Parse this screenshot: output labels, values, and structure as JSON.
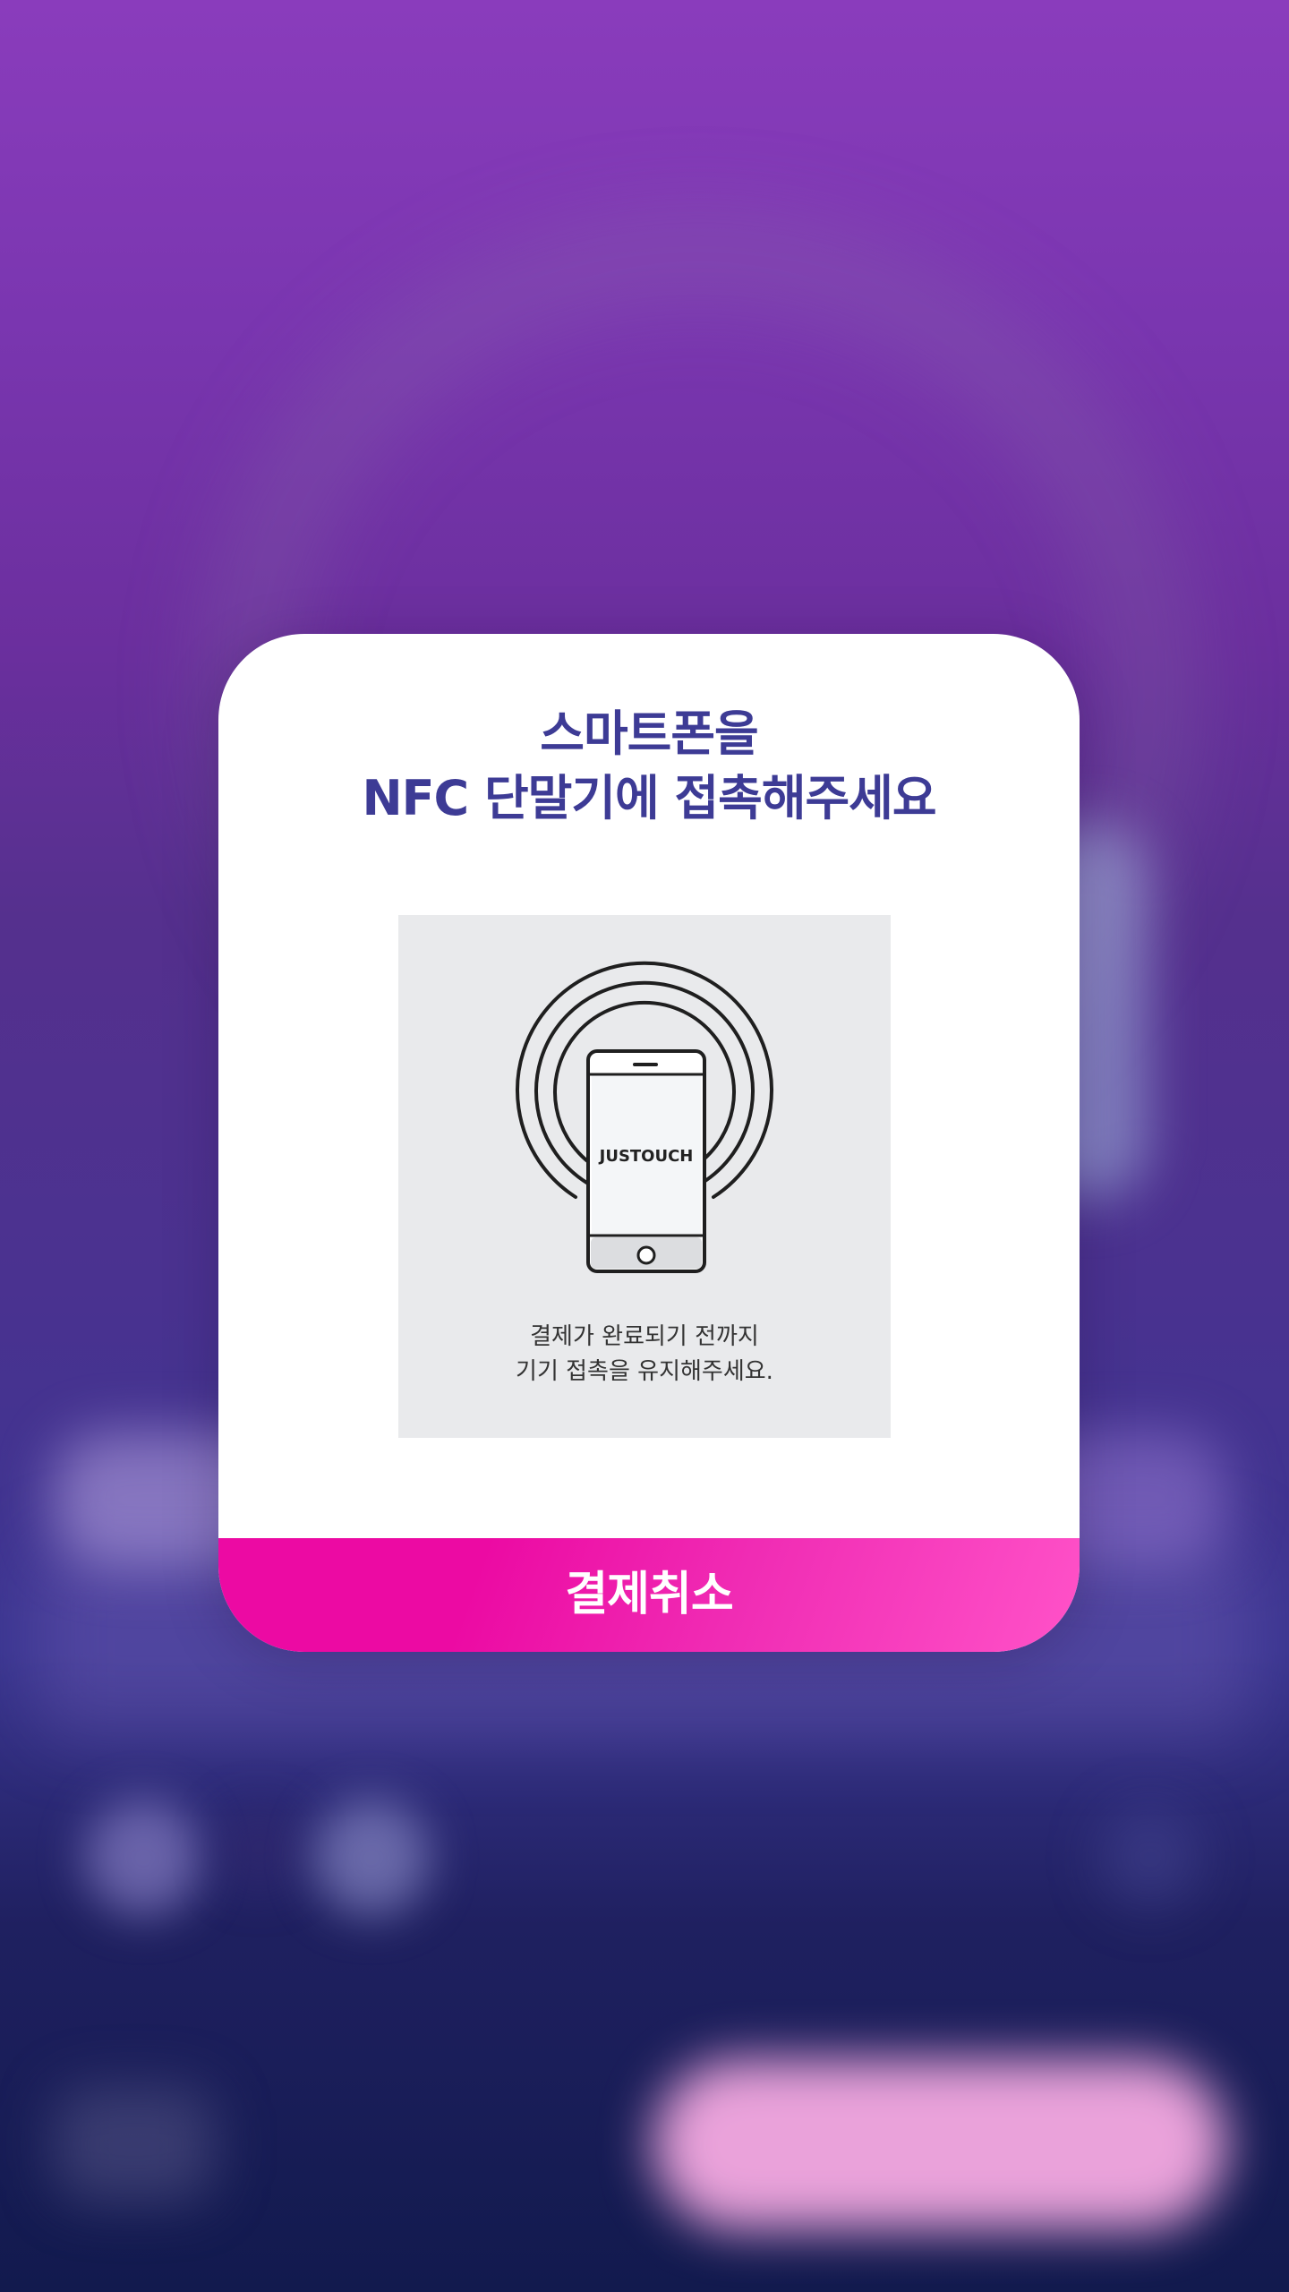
{
  "modal": {
    "title_line1": "스마트폰을",
    "title_line2": "NFC 단말기에 접촉해주세요",
    "illustration": {
      "phone_brand": "JUSTOUCH",
      "icon": "nfc-phone-icon"
    },
    "description_line1": "결제가 완료되기 전까지",
    "description_line2": "기기 접촉을 유지해주세요.",
    "cancel_label": "결제취소"
  },
  "colors": {
    "title": "#3d3b95",
    "cancel_button": "#ec0aa3",
    "illustration_bg": "#e9eaec"
  }
}
